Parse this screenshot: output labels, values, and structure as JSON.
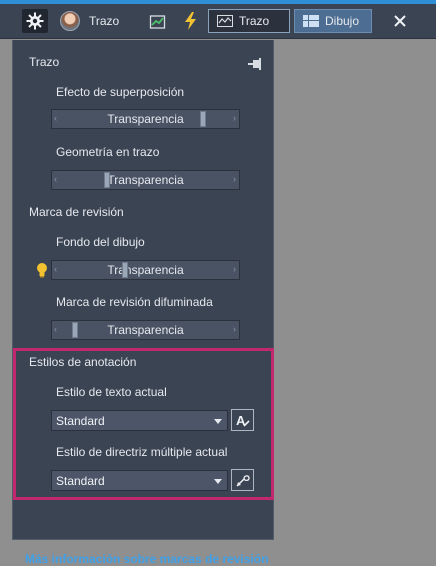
{
  "toolbar": {
    "user_name": "Trazo",
    "trazo_button": "Trazo",
    "dibujo_button": "Dibujo",
    "icons": [
      "gear-icon",
      "avatar",
      "chart-check-icon",
      "lightning-icon",
      "close-icon"
    ]
  },
  "panel": {
    "sections": {
      "trazo": "Trazo",
      "marca_revision": "Marca de revisión",
      "estilos_anotacion": "Estilos de anotación"
    },
    "rows": [
      {
        "label": "Efecto de superposición",
        "slider_text": "Transparencia",
        "level": 0.82
      },
      {
        "label": "Geometría en trazo",
        "slider_text": "Transparencia",
        "level": 0.3
      },
      {
        "label": "Fondo del dibujo",
        "slider_text": "Transparencia",
        "level": 0.38
      },
      {
        "label": "Marca de revisión difuminada",
        "slider_text": "Transparencia",
        "level": 0.12
      }
    ],
    "text_style": {
      "label": "Estilo de texto actual",
      "value": "Standard"
    },
    "multileader_style": {
      "label": "Estilo de directriz múltiple actual",
      "value": "Standard"
    }
  },
  "footer_link": "Más información sobre marcas de revisión",
  "colors": {
    "accent": "#3fa0e8",
    "highlight": "#c2286e",
    "panel": "#3b4453"
  }
}
